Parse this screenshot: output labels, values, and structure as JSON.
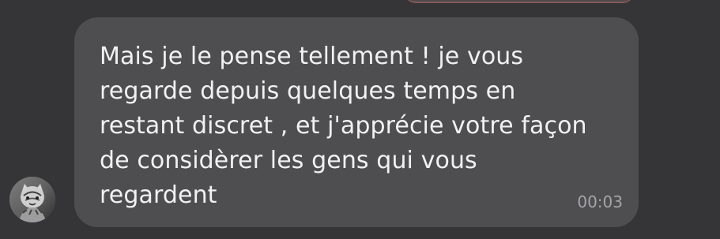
{
  "colors": {
    "background": "#353538",
    "bubble": "#4e4e51",
    "message_text": "#f1f1f1",
    "timestamp_text": "#a5a5a8",
    "previous_bubble_accent": "#8a5757"
  },
  "message": {
    "text": "Mais je le pense tellement ! je vous regarde depuis quelques temps en restant discret , et j'apprécie votre façon de considèrer les gens qui vous regardent",
    "time": "00:03"
  },
  "avatar": {
    "icon": "profile-photo-icon"
  }
}
